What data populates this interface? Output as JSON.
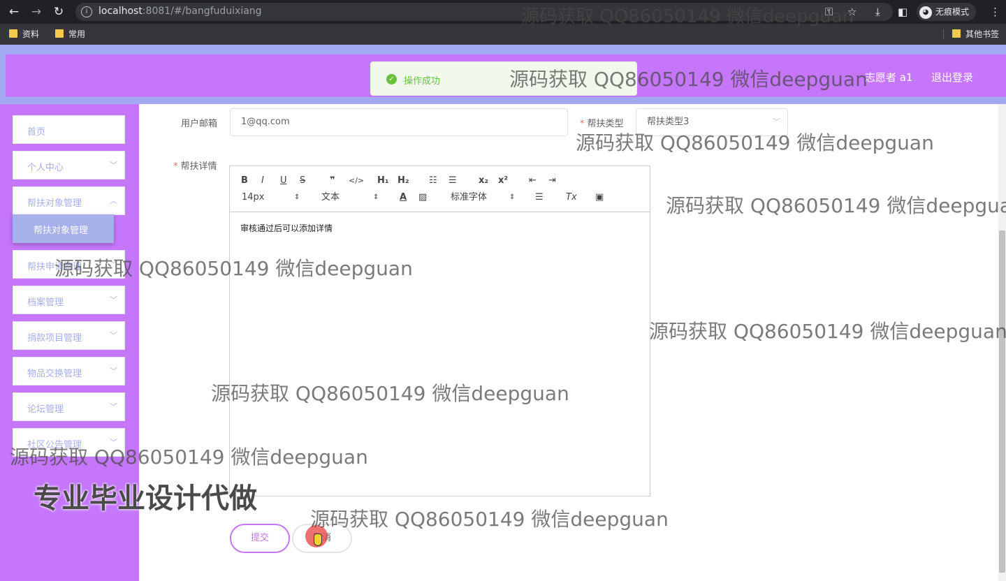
{
  "browser": {
    "url_host": "localhost",
    "url_rest": ":8081/#/bangfuduixiang",
    "incognito_label": "无痕模式",
    "bookmarks": [
      "资料",
      "常用"
    ],
    "other_bookmarks": "其他书签"
  },
  "header": {
    "user_label": "志愿者 a1",
    "logout_label": "退出登录"
  },
  "toast": {
    "message": "操作成功",
    "color": "#67c23a"
  },
  "sidebar": {
    "items": [
      {
        "label": "首页",
        "has_children": false
      },
      {
        "label": "个人中心",
        "has_children": true
      },
      {
        "label": "帮扶对象管理",
        "has_children": true
      },
      {
        "label": "帮扶申请管理",
        "has_children": true
      },
      {
        "label": "档案管理",
        "has_children": true
      },
      {
        "label": "捐款项目管理",
        "has_children": true
      },
      {
        "label": "物品交换管理",
        "has_children": true
      },
      {
        "label": "论坛管理",
        "has_children": true
      },
      {
        "label": "社区公告管理",
        "has_children": true
      }
    ],
    "active_submenu": "帮扶对象管理"
  },
  "form": {
    "email_label": "用户邮箱",
    "email_value": "1@qq.com",
    "type_label": "帮扶类型",
    "type_value": "帮扶类型3",
    "detail_label": "帮扶详情",
    "editor": {
      "font_size": "14px",
      "block_format": "文本",
      "font_family": "标准字体",
      "content": "审核通过后可以添加详情"
    },
    "submit_label": "提交",
    "cancel_label": "取消"
  },
  "watermarks": {
    "text": "源码获取 QQ86050149 微信deepguan",
    "slogan": "专业毕业设计代做"
  },
  "colors": {
    "accent": "#c576fb",
    "menu_text": "#a7b0ea",
    "page_bg": "#a3a9f0"
  }
}
